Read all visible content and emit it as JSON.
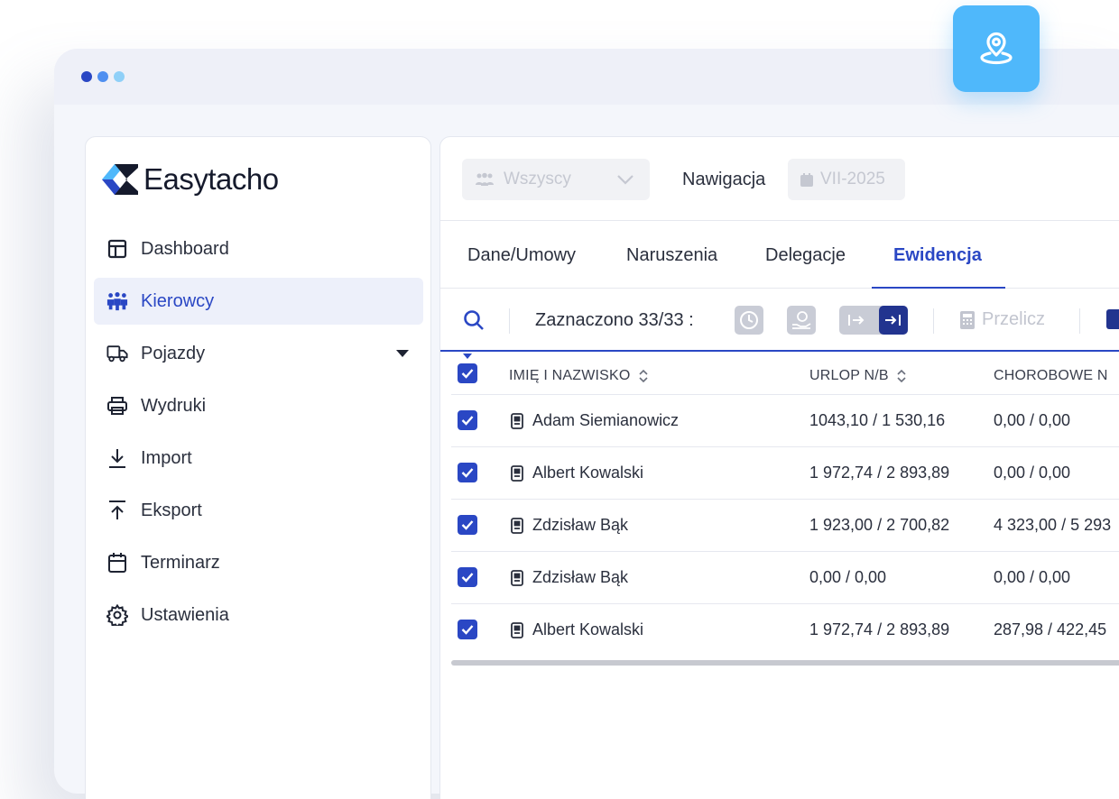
{
  "brand": {
    "name": "Easytacho",
    "accent": "#2a47c4",
    "badge_color": "#4fb8fb"
  },
  "window_dots": [
    "#2a47c4",
    "#4f8ff0",
    "#8fd0f8"
  ],
  "badge": {
    "icon": "map-pin-icon"
  },
  "sidebar": {
    "items": [
      {
        "label": "Dashboard",
        "icon": "layout-icon"
      },
      {
        "label": "Kierowcy",
        "icon": "users-icon",
        "active": true
      },
      {
        "label": "Pojazdy",
        "icon": "truck-icon",
        "expandable": true
      },
      {
        "label": "Wydruki",
        "icon": "printer-icon"
      },
      {
        "label": "Import",
        "icon": "download-icon"
      },
      {
        "label": "Eksport",
        "icon": "upload-icon"
      },
      {
        "label": "Terminarz",
        "icon": "calendar-icon"
      },
      {
        "label": "Ustawienia",
        "icon": "settings-icon"
      }
    ]
  },
  "topbar": {
    "group_select": {
      "value": "Wszyscy"
    },
    "nav_label": "Nawigacja",
    "date": "VII-2025"
  },
  "tabs": [
    {
      "label": "Dane/Umowy"
    },
    {
      "label": "Naruszenia"
    },
    {
      "label": "Delegacje"
    },
    {
      "label": "Ewidencja",
      "active": true
    }
  ],
  "toolbar": {
    "selected_text": "Zaznaczono 33/33 :",
    "recalc_label": "Przelicz"
  },
  "table": {
    "columns": [
      "IMIĘ I NAZWISKO",
      "URLOP N/B",
      "CHOROBOWE N"
    ],
    "rows": [
      {
        "name": "Adam Siemianowicz",
        "urlop": "1043,10 / 1 530,16",
        "chorobowe": "0,00 / 0,00"
      },
      {
        "name": "Albert Kowalski",
        "urlop": "1 972,74 / 2 893,89",
        "chorobowe": "0,00 / 0,00"
      },
      {
        "name": "Zdzisław Bąk",
        "urlop": "1 923,00 / 2 700,82",
        "chorobowe": "4 323,00 / 5 293"
      },
      {
        "name": "Zdzisław Bąk",
        "urlop": "0,00 / 0,00",
        "chorobowe": "0,00 / 0,00"
      },
      {
        "name": "Albert Kowalski",
        "urlop": "1 972,74 / 2 893,89",
        "chorobowe": "287,98 / 422,45"
      }
    ]
  }
}
